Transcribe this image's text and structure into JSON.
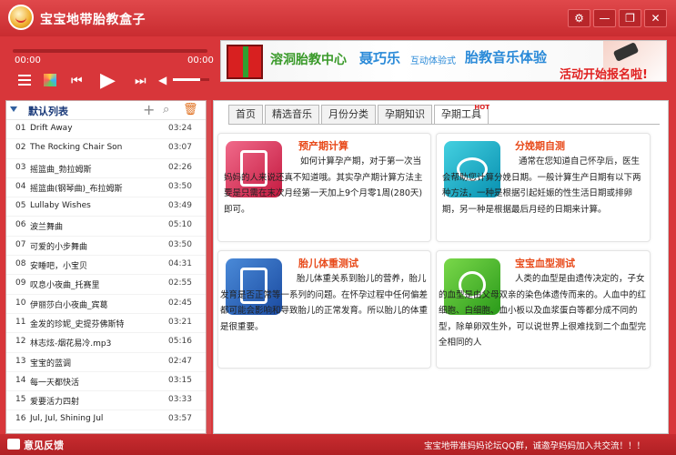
{
  "app": {
    "title": "宝宝地带胎教盒子"
  },
  "window_controls": [
    {
      "name": "settings-button",
      "label": "⚙"
    },
    {
      "name": "minimize-button",
      "label": "—"
    },
    {
      "name": "restore-button",
      "label": "❐"
    },
    {
      "name": "close-button",
      "label": "✕"
    }
  ],
  "player": {
    "time_current": "00:00",
    "time_total": "00:00",
    "volume_level": 0.75
  },
  "banner": {
    "text1": "溶洞胎教中心",
    "text2": "聂巧乐",
    "text3": "互动体验式",
    "text4": "胎教音乐体验",
    "text5": "活动开始报名啦!"
  },
  "playlist": {
    "title": "默认列表",
    "tracks": [
      {
        "num": "01",
        "name": "Drift Away",
        "dur": "03:24"
      },
      {
        "num": "02",
        "name": "The Rocking Chair Son",
        "dur": "03:07"
      },
      {
        "num": "03",
        "name": "摇篮曲_勃拉姆斯",
        "dur": "02:26"
      },
      {
        "num": "04",
        "name": "摇篮曲(钢琴曲)_布拉姆斯",
        "dur": "03:50"
      },
      {
        "num": "05",
        "name": "Lullaby Wishes",
        "dur": "03:49"
      },
      {
        "num": "06",
        "name": "波兰舞曲",
        "dur": "05:10"
      },
      {
        "num": "07",
        "name": "可爱的小步舞曲",
        "dur": "03:50"
      },
      {
        "num": "08",
        "name": "安睡吧，小宝贝",
        "dur": "04:31"
      },
      {
        "num": "09",
        "name": "叹息小夜曲_托赛里",
        "dur": "02:55"
      },
      {
        "num": "10",
        "name": "伊丽莎白小夜曲_宾葛",
        "dur": "02:45"
      },
      {
        "num": "11",
        "name": "金发的珍妮_史提芬佛斯特",
        "dur": "03:21"
      },
      {
        "num": "12",
        "name": "林志炫-烟花易冷.mp3",
        "dur": "05:16"
      },
      {
        "num": "13",
        "name": "宝宝的蓝调",
        "dur": "02:47"
      },
      {
        "num": "14",
        "name": "每一天都快活",
        "dur": "03:15"
      },
      {
        "num": "15",
        "name": "爱要活力四射",
        "dur": "03:33"
      },
      {
        "num": "16",
        "name": "Jul, Jul, Shining Jul",
        "dur": "03:57"
      }
    ]
  },
  "tabs": [
    {
      "label": "首页",
      "active": false
    },
    {
      "label": "精选音乐",
      "active": false
    },
    {
      "label": "月份分类",
      "active": false
    },
    {
      "label": "孕期知识",
      "active": false
    },
    {
      "label": "孕期工具",
      "active": true,
      "badge": "HOT"
    }
  ],
  "cards": [
    {
      "title": "预产期计算",
      "color": "#e84a1a",
      "body": "如何计算孕产期，对于第一次当妈妈的人来说还真不知道哦。其实孕产期计算方法主要是只需在末次月经第一天加上9个月零1周(280天)即可。"
    },
    {
      "title": "分娩期自测",
      "color": "#e84a1a",
      "body": "通常在您知道自己怀孕后，医生会帮助您计算分娩日期。一般计算生产日期有以下两种方法，一种是根据引起妊娠的性生活日期或排卵期，另一种是根据最后月经的日期来计算。"
    },
    {
      "title": "胎儿体重测试",
      "color": "#e84a1a",
      "body": "胎儿体重关系到胎儿的营养，胎儿发育是否正常等一系列的问题。在怀孕过程中任何偏差都可能会影响和导致胎儿的正常发育。所以胎儿的体重是很重要。"
    },
    {
      "title": "宝宝血型测试",
      "color": "#e84a1a",
      "body": "人类的血型是由遗传决定的，子女的血型是由父母双亲的染色体遗传而来的。人血中的红细胞、白细胞、血小板以及血浆蛋白等都分成不同的型，除单卵双生外，可以说世界上很难找到二个血型完全相同的人"
    }
  ],
  "footer": {
    "feedback_label": "意见反馈",
    "message": "宝宝地带准妈妈论坛QQ群，诚邀孕妈妈加入共交流！！！"
  }
}
